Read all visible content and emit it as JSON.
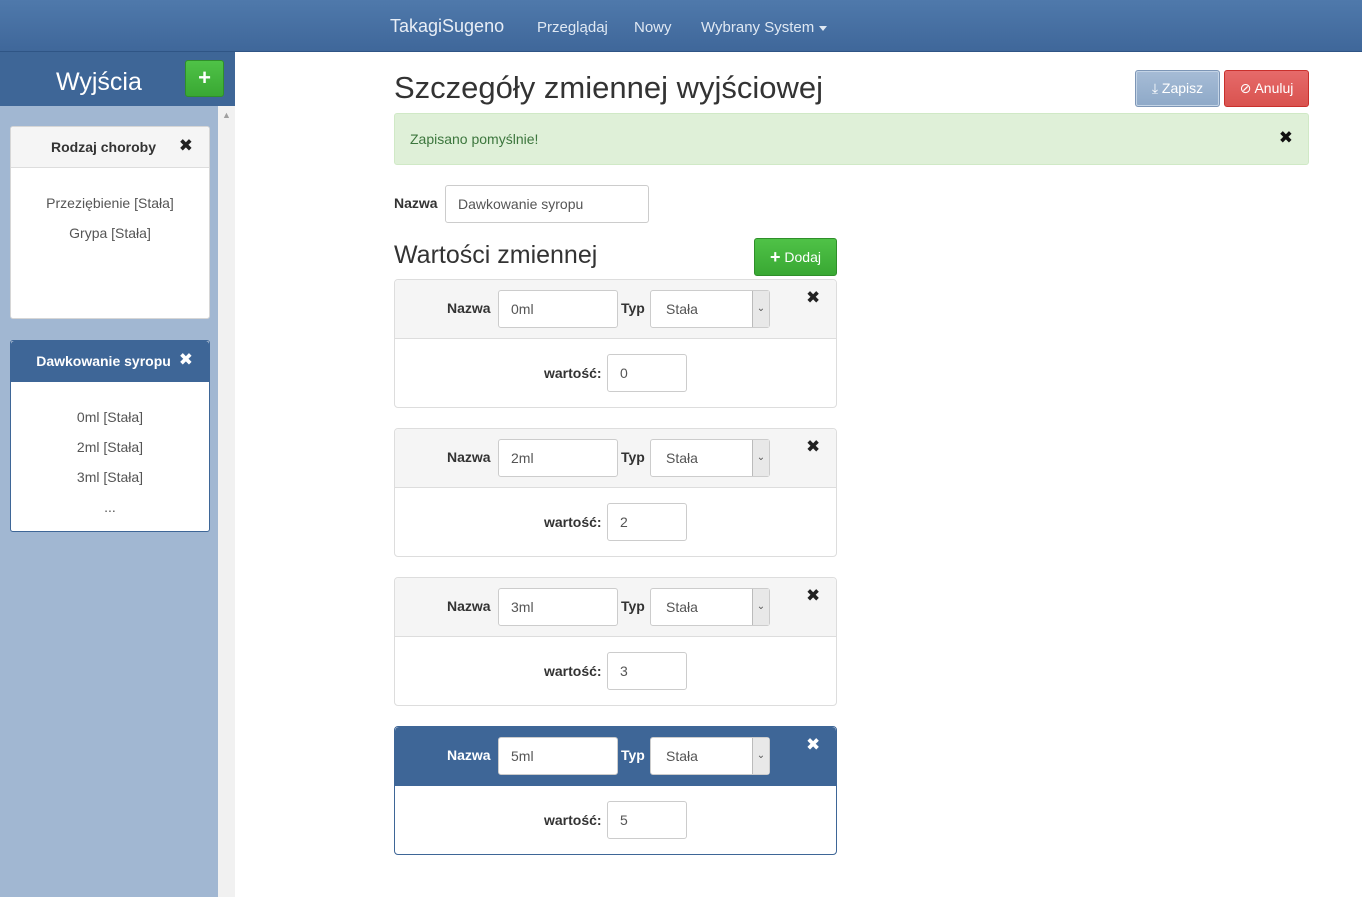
{
  "navbar": {
    "brand": "TakagiSugeno",
    "links": [
      "Przeglądaj",
      "Nowy"
    ],
    "dropdown_label": "Wybrany System"
  },
  "sidebar": {
    "title": "Wyjścia",
    "add_icon": "+",
    "cards": [
      {
        "title": "Rodzaj choroby",
        "items": [
          "Przeziębienie [Stała]",
          "Grypa [Stała]"
        ],
        "active": false
      },
      {
        "title": "Dawkowanie syropu",
        "items": [
          "0ml [Stała]",
          "2ml [Stała]",
          "3ml [Stała]",
          "..."
        ],
        "active": true
      }
    ]
  },
  "main": {
    "title": "Szczegóły zmiennej wyjściowej",
    "save_label": "Zapisz",
    "cancel_label": "Anuluj",
    "alert_text": "Zapisano pomyślnie!",
    "name_label": "Nazwa",
    "name_value": "Dawkowanie syropu",
    "values_title": "Wartości zmiennej",
    "add_label": "Dodaj",
    "value_panels": [
      {
        "name_label": "Nazwa",
        "name": "0ml",
        "type_label": "Typ",
        "type": "Stała",
        "value_label": "wartość:",
        "value": "0",
        "active": false
      },
      {
        "name_label": "Nazwa",
        "name": "2ml",
        "type_label": "Typ",
        "type": "Stała",
        "value_label": "wartość:",
        "value": "2",
        "active": false
      },
      {
        "name_label": "Nazwa",
        "name": "3ml",
        "type_label": "Typ",
        "type": "Stała",
        "value_label": "wartość:",
        "value": "3",
        "active": false
      },
      {
        "name_label": "Nazwa",
        "name": "5ml",
        "type_label": "Typ",
        "type": "Stała",
        "value_label": "wartość:",
        "value": "5",
        "active": true
      }
    ]
  },
  "colors": {
    "primary": "#3e6697",
    "success": "#39a833",
    "danger": "#d9534f",
    "alert_bg": "#dff0d8",
    "sidebar_bg": "#a1b7d2"
  },
  "icons": {
    "close": "close-icon",
    "download": "download-icon",
    "ban": "ban-icon",
    "plus": "plus-icon",
    "caret": "caret-down-icon"
  }
}
